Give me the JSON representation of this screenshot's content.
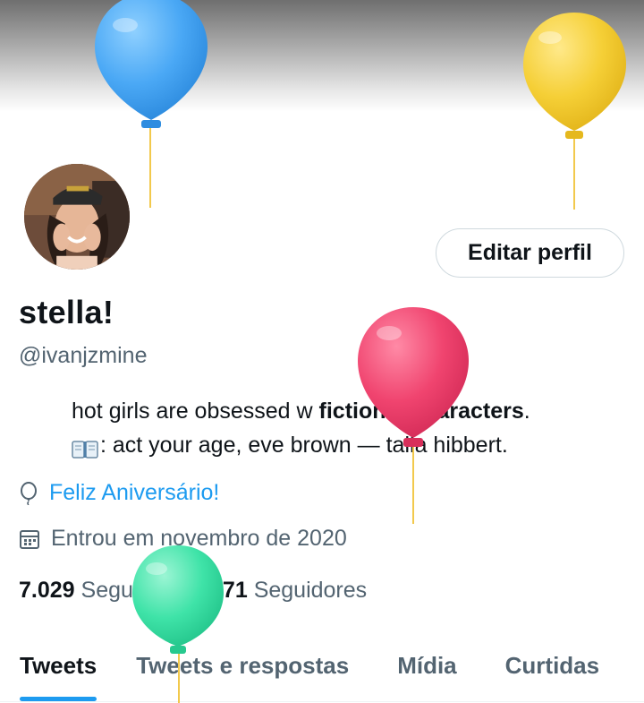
{
  "profile": {
    "name": "stella!",
    "handle": "@ivanjzmine",
    "edit_button_label": "Editar perfil",
    "bio_line1_prefix": "hot girls are obsessed w ",
    "bio_line1_bold": "fictional characters",
    "bio_line1_suffix": ".",
    "bio_line2": ": act your age, eve brown — talia hibbert.",
    "birthday_label": "Feliz Aniversário!",
    "joined_label": "Entrou em novembro de 2020"
  },
  "stats": {
    "following_count": "7.029",
    "following_label": "Seguindo",
    "followers_count": "7.071",
    "followers_label": "Seguidores"
  },
  "tabs": [
    {
      "label": "Tweets",
      "active": true
    },
    {
      "label": "Tweets e respostas",
      "active": false
    },
    {
      "label": "Mídia",
      "active": false
    },
    {
      "label": "Curtidas",
      "active": false
    }
  ],
  "colors": {
    "accent": "#1d9bf0",
    "secondary_text": "#536471",
    "balloon_blue": "#4aa8f5",
    "balloon_yellow": "#f5cf36",
    "balloon_pink": "#f0446f",
    "balloon_green": "#3fe3a8"
  },
  "icons": [
    "balloon-icon",
    "calendar-icon",
    "open-book-emoji"
  ]
}
